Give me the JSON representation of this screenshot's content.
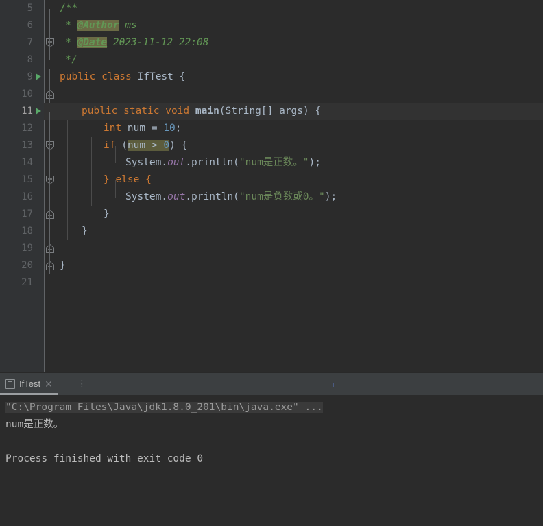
{
  "window": {
    "theme": "Darcula",
    "editor_bg": "#2b2b2b",
    "gutter_bg": "#313335",
    "caret_line_bg": "#323232",
    "accent_run_green": "#59a869"
  },
  "editor": {
    "first_line_number": 5,
    "caret_line": 11,
    "lines": [
      {
        "n": 5,
        "run": false,
        "fold": "open-start",
        "gutter_line": "none"
      },
      {
        "n": 6,
        "run": false,
        "fold": "none",
        "gutter_line": "through"
      },
      {
        "n": 7,
        "run": false,
        "fold": "none",
        "gutter_line": "through"
      },
      {
        "n": 8,
        "run": false,
        "fold": "open-end",
        "gutter_line": "none"
      },
      {
        "n": 9,
        "run": true,
        "fold": "none",
        "gutter_line": "through"
      },
      {
        "n": 10,
        "run": false,
        "fold": "none",
        "gutter_line": "through"
      },
      {
        "n": 11,
        "run": true,
        "fold": "open-start",
        "gutter_line": "through"
      },
      {
        "n": 12,
        "run": false,
        "fold": "none",
        "gutter_line": "through"
      },
      {
        "n": 13,
        "run": false,
        "fold": "open-start",
        "gutter_line": "through"
      },
      {
        "n": 14,
        "run": false,
        "fold": "none",
        "gutter_line": "through"
      },
      {
        "n": 15,
        "run": false,
        "fold": "open-end",
        "gutter_line": "through"
      },
      {
        "n": 16,
        "run": false,
        "fold": "none",
        "gutter_line": "through"
      },
      {
        "n": 17,
        "run": false,
        "fold": "open-end",
        "gutter_line": "through"
      },
      {
        "n": 18,
        "run": false,
        "fold": "open-end",
        "gutter_line": "through"
      },
      {
        "n": 19,
        "run": false,
        "fold": "none",
        "gutter_line": "through"
      },
      {
        "n": 20,
        "run": false,
        "fold": "none",
        "gutter_line": "through"
      },
      {
        "n": 21,
        "run": false,
        "fold": "none",
        "gutter_line": "through"
      }
    ],
    "code": {
      "l5": "/**",
      "l6_star": "* ",
      "l6_tag": "@Author",
      "l6_val": " ms",
      "l7_star": "* ",
      "l7_tag": "@Date",
      "l7_val": " 2023-11-12 22:08",
      "l8": "*/",
      "l9_kw": "public class ",
      "l9_name": "IfTest",
      "l9_brace": " {",
      "l11_kw1": "public static void ",
      "l11_method": "main",
      "l11_sig": "(String[] args) {",
      "l12_kw": "int ",
      "l12_rest": "num = ",
      "l12_num": "10",
      "l12_semi": ";",
      "l13_kw": "if ",
      "l13_p1": "(",
      "l13_var": "num > ",
      "l13_num": "0",
      "l13_p2": ") {",
      "l14_sys": "System.",
      "l14_out": "out",
      "l14_print": ".println(",
      "l14_str": "\"num是正数。\"",
      "l14_end": ");",
      "l15": "} else {",
      "l16_sys": "System.",
      "l16_out": "out",
      "l16_print": ".println(",
      "l16_str": "\"num是负数或0。\"",
      "l16_end": ");",
      "l17": "}",
      "l18": "}",
      "l20": "}"
    }
  },
  "run_panel": {
    "tab": {
      "label": "IfTest",
      "close_glyph": "✕",
      "more_glyph": "⋮",
      "icon_name": "run-config-icon"
    },
    "console": {
      "command_line": "\"C:\\Program Files\\Java\\jdk1.8.0_201\\bin\\java.exe\" ...",
      "output_line": "num是正数。",
      "exit_line": "Process finished with exit code 0"
    }
  }
}
